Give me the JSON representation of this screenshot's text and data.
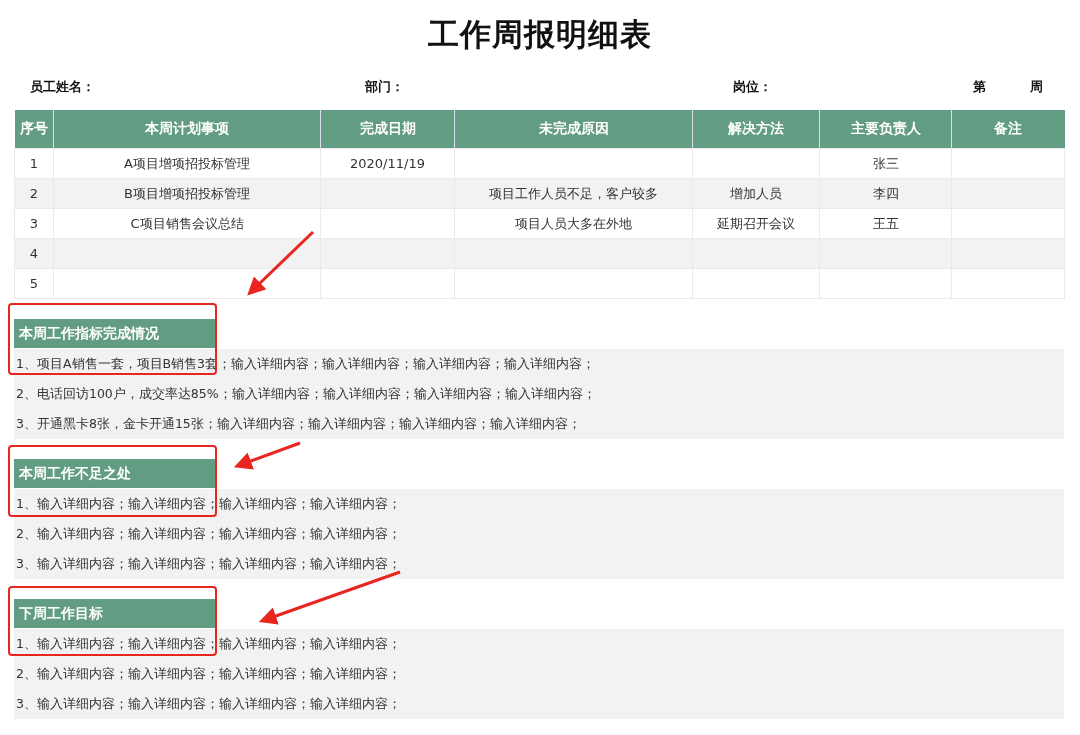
{
  "title": "工作周报明细表",
  "info_fields": [
    {
      "label": "员工姓名："
    },
    {
      "label": "部门："
    },
    {
      "label": "岗位："
    },
    {
      "label": "第"
    },
    {
      "label": "周"
    }
  ],
  "table": {
    "columns": [
      "序号",
      "本周计划事项",
      "完成日期",
      "未完成原因",
      "解决方法",
      "主要负责人",
      "备注"
    ],
    "rows": [
      {
        "cells": [
          "1",
          "A项目增项招投标管理",
          "2020/11/19",
          null,
          null,
          "张三",
          null
        ]
      },
      {
        "cells": [
          "2",
          "B项目增项招投标管理",
          null,
          "项目工作人员不足，客户较多",
          "增加人员",
          "李四",
          null
        ]
      },
      {
        "cells": [
          "3",
          "C项目销售会议总结",
          null,
          "项目人员大多在外地",
          "延期召开会议",
          "王五",
          null
        ]
      },
      {
        "cells": [
          "4",
          null,
          null,
          null,
          null,
          null,
          null
        ]
      },
      {
        "cells": [
          "5",
          null,
          null,
          null,
          null,
          null,
          null
        ]
      }
    ]
  },
  "sections": [
    {
      "heading": "本周工作指标完成情况",
      "lines": [
        "1、项目A销售一套，项目B销售3套；输入详细内容；输入详细内容；输入详细内容；输入详细内容；",
        "2、电话回访100户，成交率达85%；输入详细内容；输入详细内容；输入详细内容；输入详细内容；",
        "3、开通黑卡8张，金卡开通15张；输入详细内容；输入详细内容；输入详细内容；输入详细内容；"
      ]
    },
    {
      "heading": "本周工作不足之处",
      "lines": [
        "1、输入详细内容；输入详细内容；输入详细内容；输入详细内容；",
        "2、输入详细内容；输入详细内容；输入详细内容；输入详细内容；",
        "3、输入详细内容；输入详细内容；输入详细内容；输入详细内容；"
      ]
    },
    {
      "heading": "下周工作目标",
      "lines": [
        "1、输入详细内容；输入详细内容；输入详细内容；输入详细内容；",
        "2、输入详细内容；输入详细内容；输入详细内容；输入详细内容；",
        "3、输入详细内容；输入详细内容；输入详细内容；输入详细内容；"
      ]
    }
  ]
}
